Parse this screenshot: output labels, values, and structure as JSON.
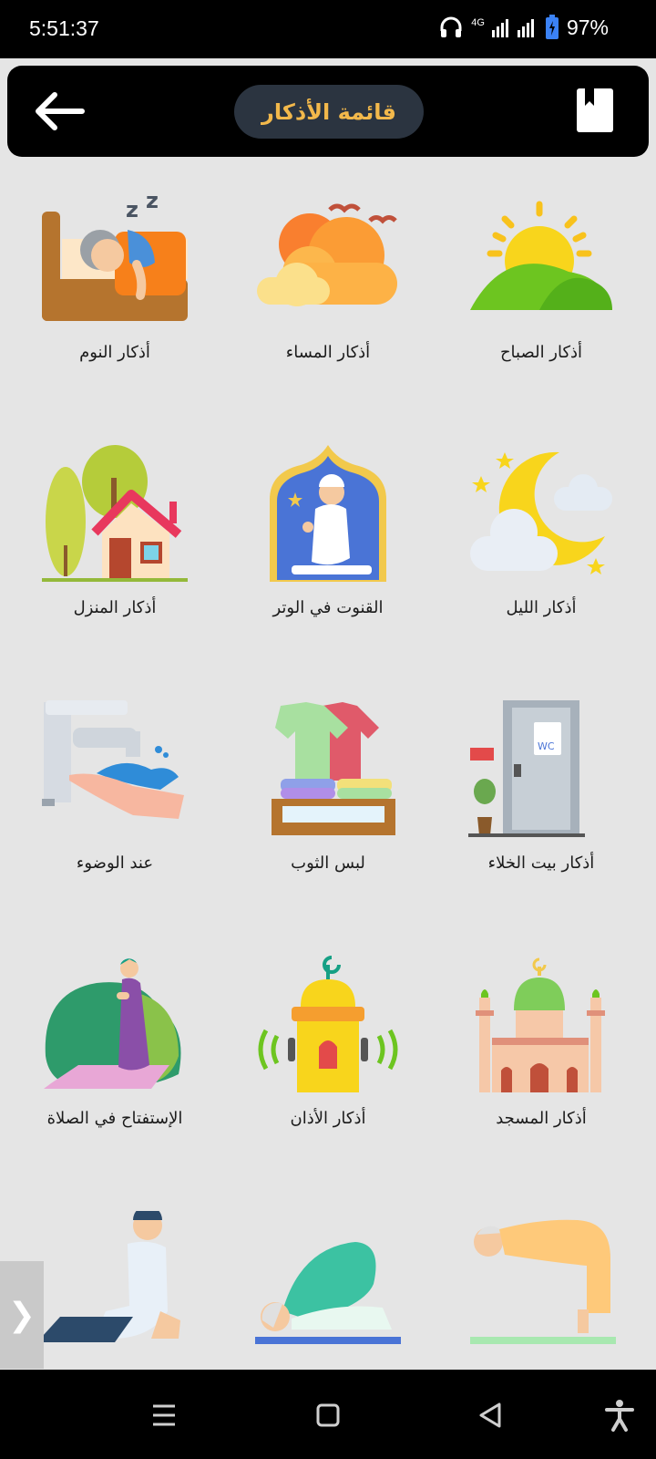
{
  "status": {
    "time": "5:51:37",
    "network": "4G",
    "battery": "97%"
  },
  "header": {
    "title": "قائمة الأذكار",
    "back_icon": "arrow-left-icon",
    "bookmark_icon": "bookmark-icon"
  },
  "items": [
    {
      "label": "أذكار الصباح",
      "icon": "sunrise-icon"
    },
    {
      "label": "أذكار المساء",
      "icon": "sunset-clouds-icon"
    },
    {
      "label": "أذكار النوم",
      "icon": "sleeping-person-icon"
    },
    {
      "label": "أذكار الليل",
      "icon": "crescent-moon-icon"
    },
    {
      "label": "القنوت في الوتر",
      "icon": "praying-man-arch-icon"
    },
    {
      "label": "أذكار المنزل",
      "icon": "house-icon"
    },
    {
      "label": "أذكار بيت الخلاء",
      "icon": "restroom-door-icon"
    },
    {
      "label": "لبس الثوب",
      "icon": "clothes-stack-icon"
    },
    {
      "label": "عند الوضوء",
      "icon": "water-tap-hand-icon"
    },
    {
      "label": "أذكار المسجد",
      "icon": "mosque-icon"
    },
    {
      "label": "أذكار الأذان",
      "icon": "minaret-speaker-icon"
    },
    {
      "label": "الإستفتاح في الصلاة",
      "icon": "standing-prayer-icon"
    },
    {
      "label": "",
      "icon": "bowing-prayer-icon"
    },
    {
      "label": "",
      "icon": "prostration-icon"
    },
    {
      "label": "",
      "icon": "sitting-prayer-icon"
    }
  ],
  "side_tab": "❯",
  "nav": {
    "menu_icon": "menu-icon",
    "home_icon": "home-square-icon",
    "back_icon": "back-triangle-icon",
    "accessibility_icon": "accessibility-icon"
  }
}
